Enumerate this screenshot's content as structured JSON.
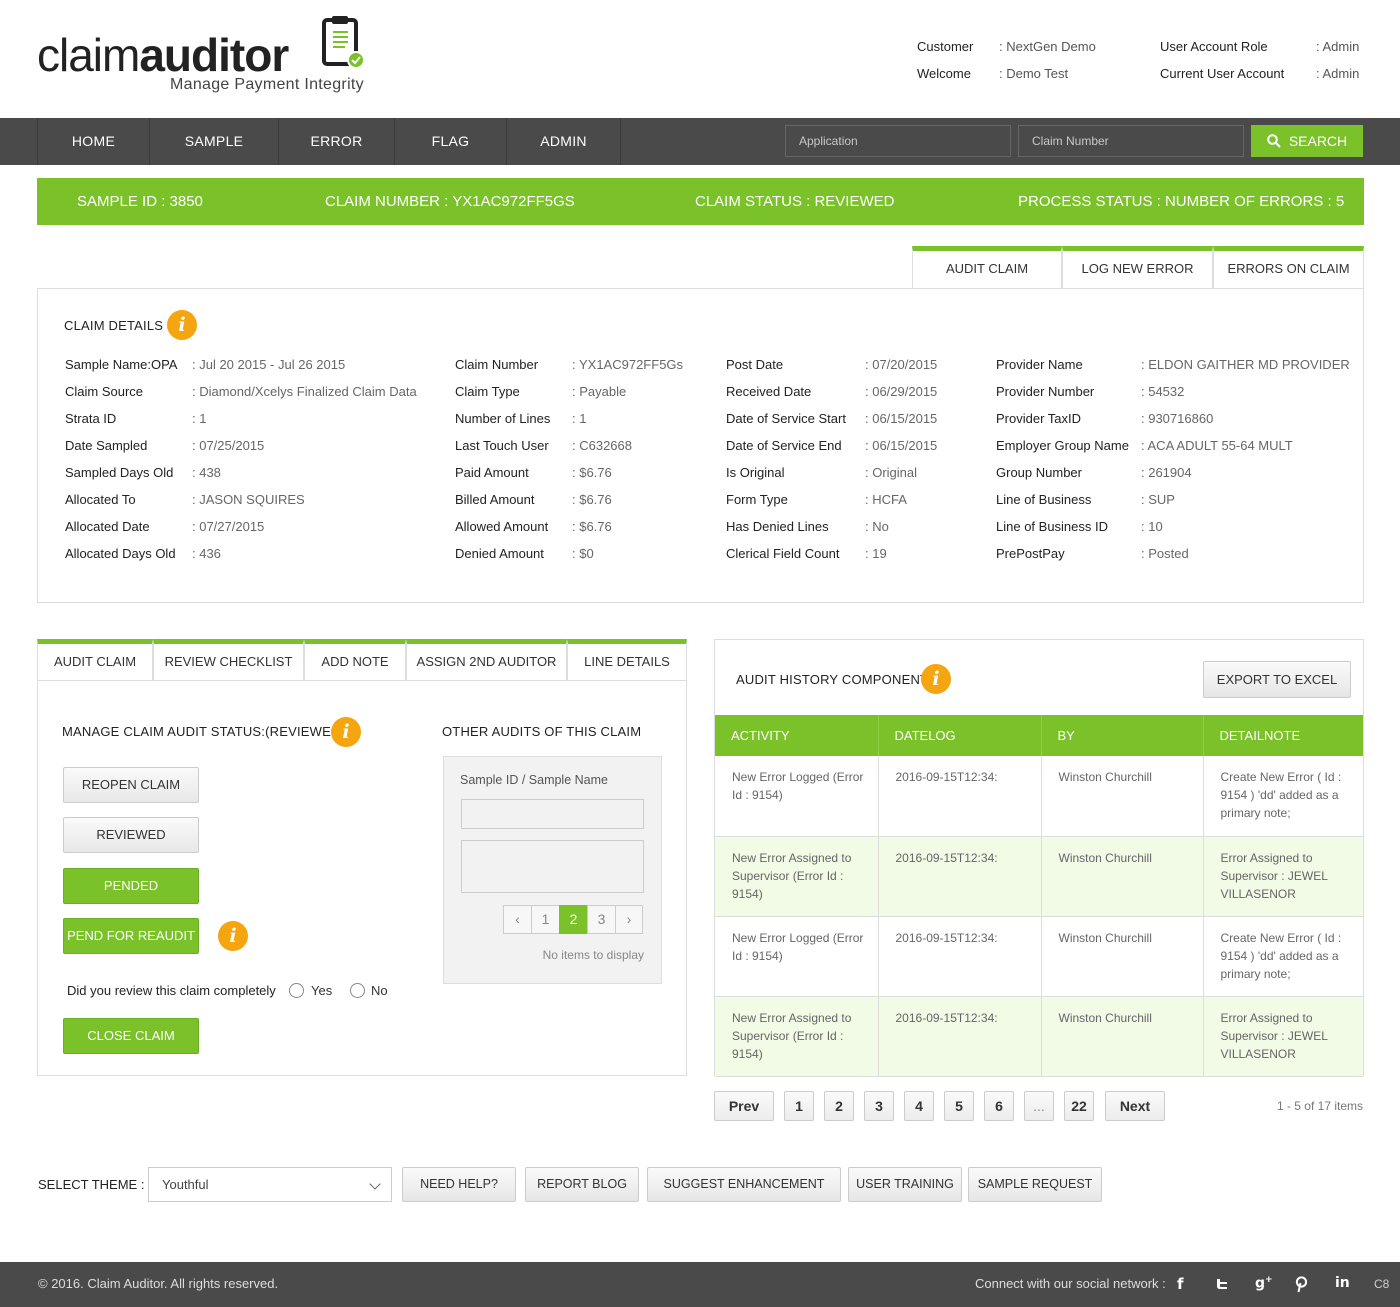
{
  "brand": {
    "logo_part1": "claim",
    "logo_part2": "auditor",
    "tagline": "Manage Payment Integrity"
  },
  "user": {
    "customer_label": "Customer",
    "customer_value": ": NextGen Demo",
    "welcome_label": "Welcome",
    "welcome_value": ": Demo Test",
    "role_label": "User Account Role",
    "role_value": ": Admin",
    "current_label": "Current User Account",
    "current_value": ": Admin"
  },
  "nav": {
    "items": [
      "HOME",
      "SAMPLE",
      "ERROR",
      "FLAG",
      "ADMIN"
    ],
    "application_placeholder": "Application",
    "claim_number_placeholder": "Claim Number",
    "search_label": "SEARCH"
  },
  "status": {
    "sample_id": "SAMPLE ID : 3850",
    "claim_number": "CLAIM NUMBER : YX1AC972FF5GS",
    "claim_status": "CLAIM STATUS : REVIEWED",
    "process_status": "PROCESS STATUS : NUMBER OF ERRORS : 5"
  },
  "top_tabs": [
    "AUDIT CLAIM",
    "LOG NEW ERROR",
    "ERRORS ON CLAIM"
  ],
  "claim_details": {
    "title": "CLAIM DETAILS",
    "columns": [
      [
        {
          "k": "Sample Name:OPA",
          "v": ": Jul 20 2015 - Jul 26 2015"
        },
        {
          "k": "Claim Source",
          "v": ": Diamond/Xcelys Finalized Claim Data"
        },
        {
          "k": "Strata ID",
          "v": ": 1"
        },
        {
          "k": "Date Sampled",
          "v": ": 07/25/2015"
        },
        {
          "k": "Sampled Days Old",
          "v": ": 438"
        },
        {
          "k": "Allocated To",
          "v": ": JASON SQUIRES"
        },
        {
          "k": "Allocated Date",
          "v": ": 07/27/2015"
        },
        {
          "k": "Allocated Days Old",
          "v": ": 436"
        }
      ],
      [
        {
          "k": "Claim Number",
          "v": ": YX1AC972FF5Gs"
        },
        {
          "k": "Claim Type",
          "v": ": Payable"
        },
        {
          "k": "Number of Lines",
          "v": ": 1"
        },
        {
          "k": "Last Touch User",
          "v": ": C632668"
        },
        {
          "k": "Paid Amount",
          "v": ": $6.76"
        },
        {
          "k": "Billed Amount",
          "v": ": $6.76"
        },
        {
          "k": "Allowed Amount",
          "v": ": $6.76"
        },
        {
          "k": "Denied Amount",
          "v": ": $0"
        }
      ],
      [
        {
          "k": "Post Date",
          "v": ": 07/20/2015"
        },
        {
          "k": "Received Date",
          "v": ": 06/29/2015"
        },
        {
          "k": "Date of Service Start",
          "v": ": 06/15/2015"
        },
        {
          "k": "Date of Service End",
          "v": ": 06/15/2015"
        },
        {
          "k": "Is Original",
          "v": ": Original"
        },
        {
          "k": "Form Type",
          "v": ": HCFA"
        },
        {
          "k": "Has Denied Lines",
          "v": ": No"
        },
        {
          "k": "Clerical Field Count",
          "v": ": 19"
        }
      ],
      [
        {
          "k": "Provider Name",
          "v": ": ELDON GAITHER MD PROVIDER"
        },
        {
          "k": "Provider Number",
          "v": ": 54532"
        },
        {
          "k": "Provider TaxID",
          "v": ": 930716860"
        },
        {
          "k": "Employer Group Name",
          "v": ": ACA ADULT 55-64 MULT"
        },
        {
          "k": "Group Number",
          "v": ": 261904"
        },
        {
          "k": "Line of Business",
          "v": ": SUP"
        },
        {
          "k": "Line of Business ID",
          "v": ": 10"
        },
        {
          "k": "PrePostPay",
          "v": ": Posted"
        }
      ]
    ]
  },
  "audit_tabs": [
    "AUDIT CLAIM",
    "REVIEW CHECKLIST",
    "ADD NOTE",
    "ASSIGN 2ND AUDITOR",
    "LINE DETAILS"
  ],
  "audit_panel": {
    "manage_title": "MANAGE CLAIM AUDIT STATUS:(REVIEWED)",
    "other_title": "OTHER AUDITS OF THIS CLAIM",
    "buttons": {
      "reopen": "REOPEN CLAIM",
      "reviewed": "REVIEWED",
      "pended": "PENDED",
      "pend_reaudit": "PEND FOR REAUDIT",
      "close": "CLOSE CLAIM"
    },
    "question": "Did you review this claim completely",
    "yes": "Yes",
    "no": "No",
    "other_label": "Sample ID / Sample Name",
    "pages": [
      "‹",
      "1",
      "2",
      "3",
      "›"
    ],
    "no_items": "No items to display"
  },
  "history": {
    "title": "AUDIT HISTORY COMPONENT",
    "export_label": "EXPORT TO EXCEL",
    "columns": [
      "ACTIVITY",
      "DATELOG",
      "BY",
      "DETAILNOTE"
    ],
    "rows": [
      [
        "New Error Logged (Error Id : 9154)",
        "2016-09-15T12:34:",
        "Winston Churchill",
        "Create New Error ( Id : 9154 ) 'dd' added as a primary note;"
      ],
      [
        "New Error Assigned to Supervisor (Error Id : 9154)",
        "2016-09-15T12:34:",
        "Winston Churchill",
        "Error Assigned to Supervisor : JEWEL VILLASENOR"
      ],
      [
        "New Error Logged (Error Id : 9154)",
        "2016-09-15T12:34:",
        "Winston Churchill",
        "Create New Error ( Id : 9154 ) 'dd' added as a primary note;"
      ],
      [
        "New Error Assigned to Supervisor (Error Id : 9154)",
        "2016-09-15T12:34:",
        "Winston Churchill",
        "Error Assigned to Supervisor : JEWEL VILLASENOR"
      ]
    ],
    "pager": [
      "Prev",
      "1",
      "2",
      "3",
      "4",
      "5",
      "6",
      "...",
      "22",
      "Next"
    ],
    "pager_info": "1 - 5 of 17 items"
  },
  "toolbar": {
    "theme_label": "SELECT THEME :",
    "theme_value": "Youthful",
    "buttons": [
      "NEED HELP?",
      "REPORT BLOG",
      "SUGGEST ENHANCEMENT",
      "USER TRAINING",
      "SAMPLE REQUEST"
    ]
  },
  "footer": {
    "copyright": "© 2016. Claim Auditor. All rights reserved.",
    "connect": "Connect with our social network :",
    "social_icons": [
      "facebook-icon",
      "twitter-icon",
      "google-plus-icon",
      "pinterest-icon",
      "linkedin-icon"
    ],
    "version": "C8"
  },
  "colors": {
    "accent": "#7ac12a",
    "nav_bg": "#4a4a4a",
    "info": "#f5a50f"
  }
}
